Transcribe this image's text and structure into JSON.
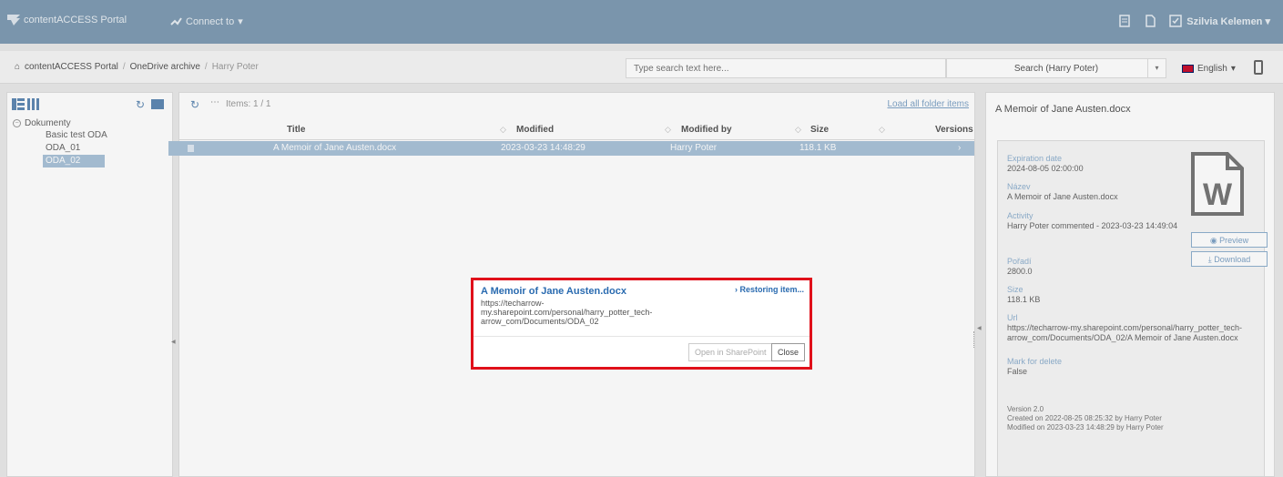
{
  "topbar": {
    "logo_text": "contentACCESS Portal",
    "connect_label": "Connect to",
    "user_name": "Szilvia Kelemen",
    "icons": [
      "report-icon",
      "document-icon",
      "task-icon"
    ]
  },
  "breadcrumb": {
    "items": [
      "contentACCESS Portal",
      "OneDrive archive",
      "Harry Poter"
    ]
  },
  "search": {
    "placeholder": "Type search text here...",
    "scope": "Search (Harry Poter)"
  },
  "language": "English",
  "tree": {
    "root": "Dokumenty",
    "items": [
      "Basic test ODA",
      "ODA_01",
      "ODA_02"
    ],
    "selected": "ODA_02"
  },
  "list": {
    "items_count": "Items: 1 / 1",
    "load_all": "Load all folder items",
    "columns": [
      "Title",
      "Modified",
      "Modified by",
      "Size",
      "Versions"
    ],
    "rows": [
      {
        "title": "A Memoir of Jane Austen.docx",
        "modified": "2023-03-23 14:48:29",
        "modified_by": "Harry Poter",
        "size": "118.1 KB"
      }
    ]
  },
  "details": {
    "header": "A Memoir of Jane Austen.docx",
    "props": [
      {
        "key": "Expiration date",
        "value": "2024-08-05 02:00:00"
      },
      {
        "key": "Název",
        "value": "A Memoir of Jane Austen.docx"
      },
      {
        "key": "Activity",
        "value": "Harry Poter commented - 2023-03-23 14:49:04"
      },
      {
        "key": "Pořadí",
        "value": "2800.0"
      },
      {
        "key": "Size",
        "value": "118.1 KB"
      },
      {
        "key": "Url",
        "value": "https://techarrow-my.sharepoint.com/personal/harry_potter_tech-arrow_com/Documents/ODA_02/A Memoir of Jane Austen.docx"
      },
      {
        "key": "Mark for delete",
        "value": "False"
      }
    ],
    "preview_label": "Preview",
    "download_label": "Download",
    "version": "Version 2.0",
    "created": "Created on 2022-08-25 08:25:32 by Harry Poter",
    "modified": "Modified on 2023-03-23 14:48:29 by Harry Poter"
  },
  "modal": {
    "title": "A Memoir of Jane Austen.docx",
    "status": "Restoring item...",
    "url": "https://techarrow-my.sharepoint.com/personal/harry_potter_tech-arrow_com/Documents/ODA_02",
    "open_label": "Open in SharePoint",
    "close_label": "Close"
  },
  "colors": {
    "topbar": "#7f9cb3",
    "accent": "#5f89b4",
    "selection": "#a9c2d8",
    "highlight_border": "#e0101a"
  }
}
